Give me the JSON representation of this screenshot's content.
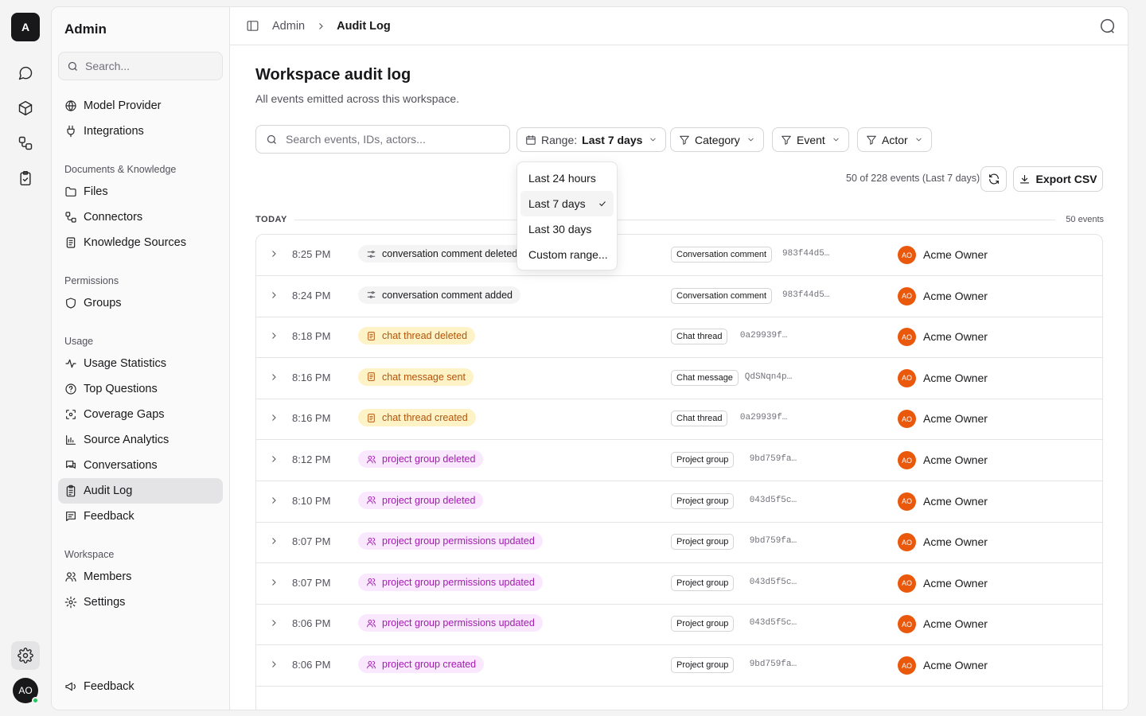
{
  "rail": {
    "logo": "A",
    "avatar": "AO"
  },
  "sidebar": {
    "title": "Admin",
    "search_placeholder": "Search...",
    "top_items": [
      {
        "label": "Model Provider",
        "icon": "globe-icon"
      },
      {
        "label": "Integrations",
        "icon": "plug-icon"
      }
    ],
    "groups": [
      {
        "label": "Documents & Knowledge",
        "items": [
          "Files",
          "Connectors",
          "Knowledge Sources"
        ]
      },
      {
        "label": "Permissions",
        "items": [
          "Groups"
        ]
      },
      {
        "label": "Usage",
        "items": [
          "Usage Statistics",
          "Top Questions",
          "Coverage Gaps",
          "Source Analytics",
          "Conversations",
          "Audit Log",
          "Feedback"
        ]
      },
      {
        "label": "Workspace",
        "items": [
          "Members",
          "Settings"
        ]
      }
    ],
    "bottom_item": "Feedback"
  },
  "header": {
    "breadcrumb": [
      "Admin",
      "Audit Log"
    ]
  },
  "page": {
    "title": "Workspace audit log",
    "subtitle": "All events emitted across this workspace."
  },
  "filters": {
    "search_placeholder": "Search events, IDs, actors...",
    "range_label": "Range:",
    "range_value": "Last 7 days",
    "category": "Category",
    "event": "Event",
    "actor": "Actor"
  },
  "range_menu": {
    "options": [
      "Last 24 hours",
      "Last 7 days",
      "Last 30 days",
      "Custom range..."
    ],
    "selected": "Last 7 days"
  },
  "summary": {
    "count_text": "50 of 228 events (Last 7 days)",
    "export_label": "Export CSV"
  },
  "section": {
    "label": "TODAY",
    "count": "50 events"
  },
  "rows": [
    {
      "time": "8:25 PM",
      "event": "conversation comment deleted",
      "kind": "gray",
      "resource": "Conversation comment",
      "id": "983f44d5…",
      "actor_initials": "AO",
      "actor": "Acme Owner"
    },
    {
      "time": "8:24 PM",
      "event": "conversation comment added",
      "kind": "gray",
      "resource": "Conversation comment",
      "id": "983f44d5…",
      "actor_initials": "AO",
      "actor": "Acme Owner"
    },
    {
      "time": "8:18 PM",
      "event": "chat thread deleted",
      "kind": "yellow",
      "resource": "Chat thread",
      "id": "0a29939f…",
      "actor_initials": "AO",
      "actor": "Acme Owner"
    },
    {
      "time": "8:16 PM",
      "event": "chat message sent",
      "kind": "yellow",
      "resource": "Chat message",
      "id": "QdSNqn4p…",
      "actor_initials": "AO",
      "actor": "Acme Owner"
    },
    {
      "time": "8:16 PM",
      "event": "chat thread created",
      "kind": "yellow",
      "resource": "Chat thread",
      "id": "0a29939f…",
      "actor_initials": "AO",
      "actor": "Acme Owner"
    },
    {
      "time": "8:12 PM",
      "event": "project group deleted",
      "kind": "purple",
      "resource": "Project group",
      "id": "9bd759fa…",
      "actor_initials": "AO",
      "actor": "Acme Owner"
    },
    {
      "time": "8:10 PM",
      "event": "project group deleted",
      "kind": "purple",
      "resource": "Project group",
      "id": "043d5f5c…",
      "actor_initials": "AO",
      "actor": "Acme Owner"
    },
    {
      "time": "8:07 PM",
      "event": "project group permissions updated",
      "kind": "purple",
      "resource": "Project group",
      "id": "9bd759fa…",
      "actor_initials": "AO",
      "actor": "Acme Owner"
    },
    {
      "time": "8:07 PM",
      "event": "project group permissions updated",
      "kind": "purple",
      "resource": "Project group",
      "id": "043d5f5c…",
      "actor_initials": "AO",
      "actor": "Acme Owner"
    },
    {
      "time": "8:06 PM",
      "event": "project group permissions updated",
      "kind": "purple",
      "resource": "Project group",
      "id": "043d5f5c…",
      "actor_initials": "AO",
      "actor": "Acme Owner"
    },
    {
      "time": "8:06 PM",
      "event": "project group created",
      "kind": "purple",
      "resource": "Project group",
      "id": "9bd759fa…",
      "actor_initials": "AO",
      "actor": "Acme Owner"
    }
  ],
  "colors": {
    "accent_avatar": "#ea580c",
    "yellow_tag_bg": "#fef3c7",
    "purple_tag_bg": "#fae8ff",
    "online": "#22c55e"
  }
}
